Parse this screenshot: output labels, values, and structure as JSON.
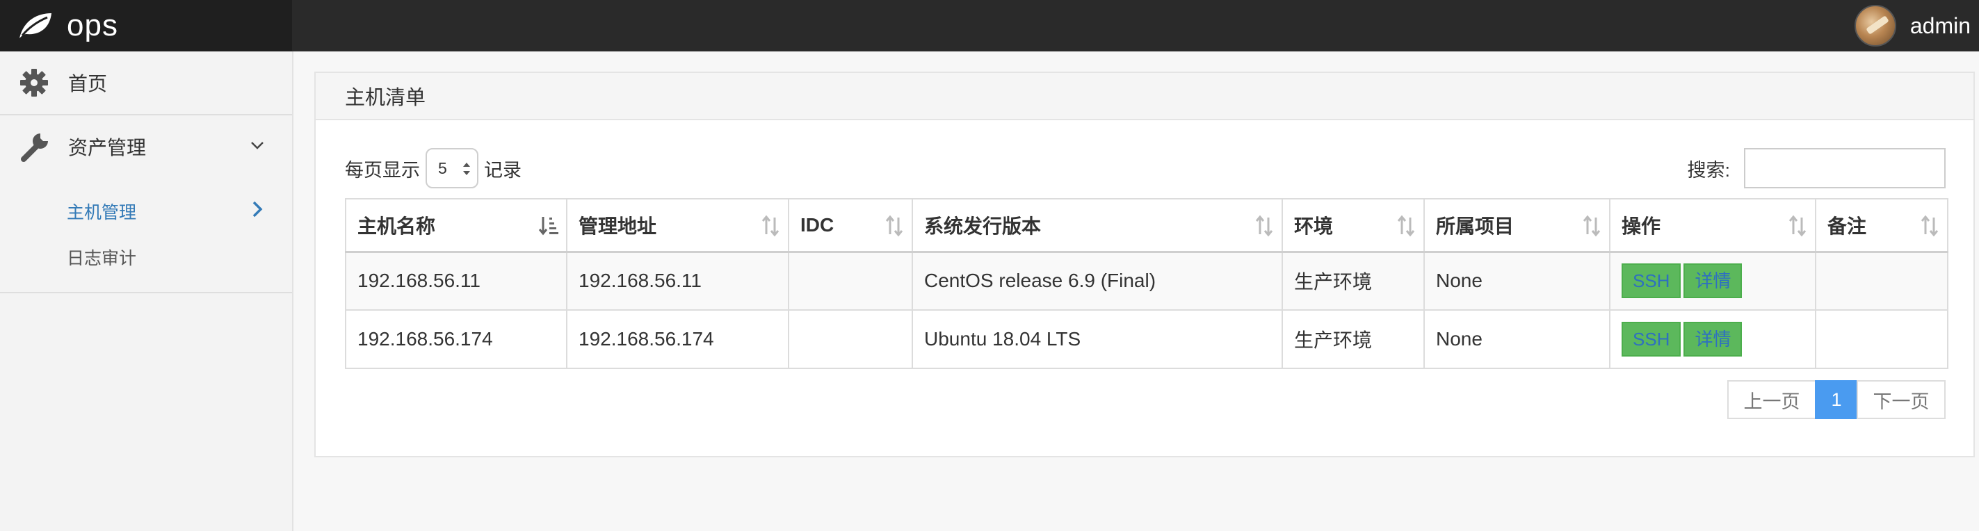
{
  "app": {
    "brand": "ops",
    "username": "admin"
  },
  "sidebar": {
    "home_label": "首页",
    "assets_label": "资产管理",
    "sub_items": [
      {
        "label": "主机管理"
      },
      {
        "label": "日志审计"
      }
    ]
  },
  "panel": {
    "title": "主机清单",
    "length_prefix": "每页显示",
    "length_value": "5",
    "length_suffix": "记录",
    "search_label": "搜索:",
    "search_value": ""
  },
  "table": {
    "columns": [
      "主机名称",
      "管理地址",
      "IDC",
      "系统发行版本",
      "环境",
      "所属项目",
      "操作",
      "备注"
    ],
    "rows": [
      {
        "hostname": "192.168.56.11",
        "address": "192.168.56.11",
        "idc": "",
        "os": "CentOS release 6.9 (Final)",
        "env": "生产环境",
        "project": "None",
        "remark": ""
      },
      {
        "hostname": "192.168.56.174",
        "address": "192.168.56.174",
        "idc": "",
        "os": "Ubuntu 18.04 LTS",
        "env": "生产环境",
        "project": "None",
        "remark": ""
      }
    ],
    "action_ssh": "SSH",
    "action_detail": "详情"
  },
  "pagination": {
    "prev": "上一页",
    "current": "1",
    "next": "下一页"
  },
  "colors": {
    "accent": "#337ab7",
    "button_green": "#5cb85c",
    "page_active": "#4a9bf0"
  }
}
